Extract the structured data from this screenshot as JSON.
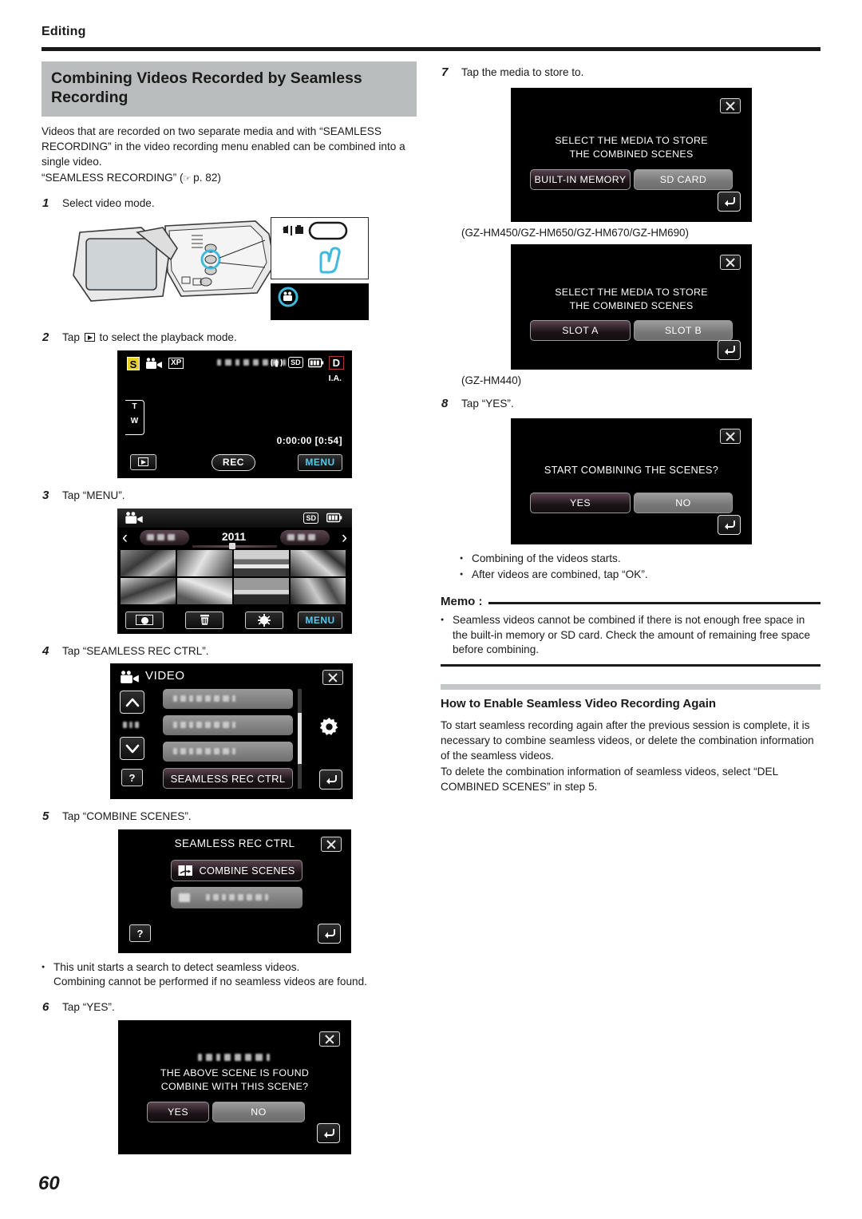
{
  "header": {
    "section": "Editing"
  },
  "page_number": "60",
  "title": "Combining Videos Recorded by Seamless Recording",
  "intro": {
    "paragraph": "Videos that are recorded on two separate media and with “SEAMLESS RECORDING” in the video recording menu enabled can be combined into a single video.",
    "reference": "“SEAMLESS RECORDING” (",
    "reference_page": " p. 82)"
  },
  "steps": {
    "s1": {
      "num": "1",
      "text": "Select video mode."
    },
    "s2": {
      "num": "2",
      "text_before": "Tap",
      "text_after": "to select the playback mode."
    },
    "s3": {
      "num": "3",
      "text": "Tap “MENU”."
    },
    "s4": {
      "num": "4",
      "text": "Tap “SEAMLESS REC CTRL”."
    },
    "s5": {
      "num": "5",
      "text": "Tap “COMBINE SCENES”."
    },
    "s6": {
      "num": "6",
      "text": "Tap “YES”."
    },
    "s7": {
      "num": "7",
      "text": "Tap the media to store to."
    },
    "s8": {
      "num": "8",
      "text": "Tap “YES”."
    }
  },
  "rec_screen": {
    "icon_s": "S",
    "icon_video": "video-camera",
    "quality": "XP",
    "icon_stabilizer": "image-stabilizer",
    "icon_sd": "SD",
    "icon_battery": "battery",
    "icon_d": "D",
    "intelligent_auto": "I.A.",
    "zoom_t": "T",
    "zoom_w": "W",
    "timecode": "0:00:00",
    "remaining": "[0:54]",
    "rec_label": "REC",
    "menu_label": "MENU"
  },
  "index_screen": {
    "year": "2011",
    "icon_sd": "SD",
    "icon_battery": "battery",
    "prev_arrow": "‹",
    "next_arrow": "›",
    "menu_label": "MENU"
  },
  "video_menu": {
    "title": "VIDEO",
    "highlighted_item": "SEAMLESS REC CTRL",
    "help_label": "?",
    "up_arrow": "up-chevron",
    "down_arrow": "down-chevron",
    "gear_icon": "gear-icon"
  },
  "seamless_menu": {
    "title": "SEAMLESS REC CTRL",
    "item_combine": "COMBINE SCENES",
    "help_label": "?"
  },
  "confirm_found": {
    "line1": "THE ABOVE SCENE IS FOUND",
    "line2": "COMBINE WITH THIS SCENE?",
    "yes": "YES",
    "no": "NO"
  },
  "select_media_a": {
    "line1": "SELECT THE MEDIA TO STORE",
    "line2": "THE COMBINED SCENES",
    "option_1": "BUILT-IN MEMORY",
    "option_2": "SD CARD",
    "caption": "(GZ-HM450/GZ-HM650/GZ-HM670/GZ-HM690)"
  },
  "select_media_b": {
    "line1": "SELECT THE MEDIA TO STORE",
    "line2": "THE COMBINED SCENES",
    "option_1": "SLOT A",
    "option_2": "SLOT B",
    "caption": "(GZ-HM440)"
  },
  "confirm_start": {
    "line1": "START COMBINING THE SCENES?",
    "yes": "YES",
    "no": "NO"
  },
  "notes_left": {
    "b1": "This unit starts a search to detect seamless videos.",
    "b1_cont": "Combining cannot be performed if no seamless videos are found."
  },
  "notes_right": {
    "b1": "Combining of the videos starts.",
    "b2": "After videos are combined, tap “OK”."
  },
  "memo": {
    "label": "Memo :",
    "bullet": "Seamless videos cannot be combined if there is not enough free space in the built-in memory or SD card. Check the amount of remaining free space before combining."
  },
  "subsection": {
    "heading": "How to Enable Seamless Video Recording Again",
    "p1": "To start seamless recording again after the previous session is complete, it is necessary to combine seamless videos, or delete the combination information of the seamless videos.",
    "p2": "To delete the combination information of seamless videos, select “DEL COMBINED SCENES” in step 5."
  },
  "colors": {
    "band": "#b9bdbd",
    "accent_cyan": "#57c8e8",
    "highlight_yellow": "#e8d22a",
    "lcd_black": "#000000"
  }
}
